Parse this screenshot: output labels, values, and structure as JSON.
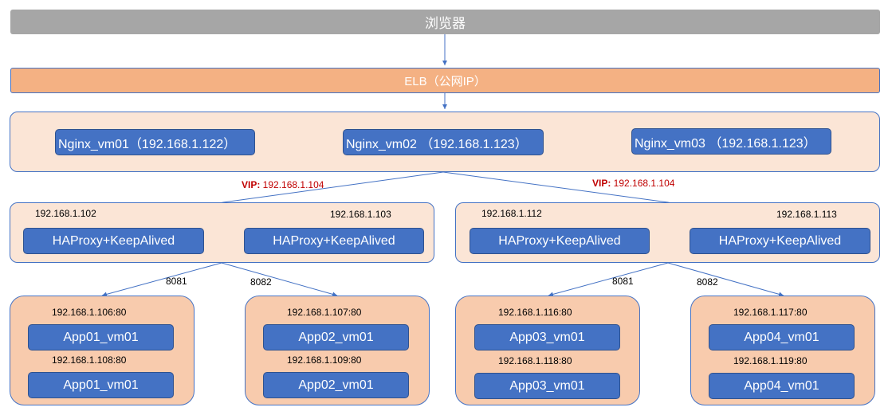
{
  "browser": {
    "label": "浏览器"
  },
  "elb": {
    "label": "ELB（公网IP）"
  },
  "nginx": [
    {
      "label": "Nginx_vm01（192.168.1.122）"
    },
    {
      "label": "Nginx_vm02 （192.168.1.123）"
    },
    {
      "label": "Nginx_vm03 （192.168.1.123）"
    }
  ],
  "vip_left": {
    "prefix": "VIP:",
    "ip": " 192.168.1.104"
  },
  "vip_right": {
    "prefix": "VIP:",
    "ip": " 192.168.1.104"
  },
  "haproxy_left": {
    "ip1": "192.168.1.102",
    "ip2": "192.168.1.103",
    "node1": "HAProxy+KeepAlived",
    "node2": "HAProxy+KeepAlived"
  },
  "haproxy_right": {
    "ip1": "192.168.1.112",
    "ip2": "192.168.1.113",
    "node1": "HAProxy+KeepAlived",
    "node2": "HAProxy+KeepAlived"
  },
  "ports": {
    "p1": "8081",
    "p2": "8082",
    "p3": "8081",
    "p4": "8082"
  },
  "apps": [
    {
      "ip1": "192.168.1.106:80",
      "name1": "App01_vm01",
      "ip2": "192.168.1.108:80",
      "name2": "App01_vm01"
    },
    {
      "ip1": "192.168.1.107:80",
      "name1": "App02_vm01",
      "ip2": "192.168.1.109:80",
      "name2": "App02_vm01"
    },
    {
      "ip1": "192.168.1.116:80",
      "name1": "App03_vm01",
      "ip2": "192.168.1.118:80",
      "name2": "App03_vm01"
    },
    {
      "ip1": "192.168.1.117:80",
      "name1": "App04_vm01",
      "ip2": "192.168.1.119:80",
      "name2": "App04_vm01"
    }
  ],
  "colors": {
    "line": "#4472c4",
    "vip": "#c00000",
    "browser": "#a6a6a6",
    "elb": "#f4b183",
    "panel": "#fbe5d6",
    "app_panel": "#f8cbad",
    "node": "#4472c4"
  }
}
